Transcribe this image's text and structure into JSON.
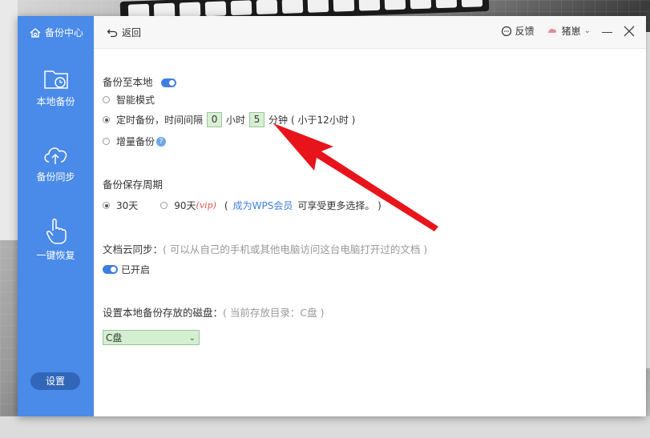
{
  "sidebar": {
    "title": "备份中心",
    "items": [
      {
        "label": "本地备份",
        "icon": "folder-clock-icon"
      },
      {
        "label": "备份同步",
        "icon": "cloud-upload-icon"
      },
      {
        "label": "一键恢复",
        "icon": "hand-pointer-icon"
      }
    ],
    "settings_label": "设置"
  },
  "topbar": {
    "back_label": "返回",
    "feedback_label": "反馈",
    "user_name": "猪崽"
  },
  "local_backup": {
    "title": "备份至本地",
    "enabled": true,
    "options": {
      "smart": "智能模式",
      "timed_prefix": "定时备份，时间间隔",
      "hours_value": "0",
      "hours_unit": "小时",
      "minutes_value": "5",
      "minutes_unit": "分钟",
      "timed_note": "( 小于12小时 )",
      "incremental": "增量备份"
    },
    "selected": "timed"
  },
  "retention": {
    "title": "备份保存周期",
    "option_30": "30天",
    "option_90": "90天",
    "vip_tag": "(vip)",
    "note_open": "(",
    "member_link": "成为WPS会员",
    "note_rest": "可享受更多选择。 )",
    "selected": "30"
  },
  "cloud_sync": {
    "title": "文档云同步：",
    "note": "( 可以从自己的手机或其他电脑访问这台电脑打开过的文档 )",
    "status_label": "已开启",
    "enabled": true
  },
  "disk": {
    "title": "设置本地备份存放的磁盘：",
    "note": "( 当前存放目录：C盘 )",
    "selected_value": "C盘"
  },
  "colors": {
    "sidebar": "#4a8ae8",
    "accent": "#3f7fe0",
    "arrow": "#e8141c",
    "input_bg": "#d8efd3"
  }
}
